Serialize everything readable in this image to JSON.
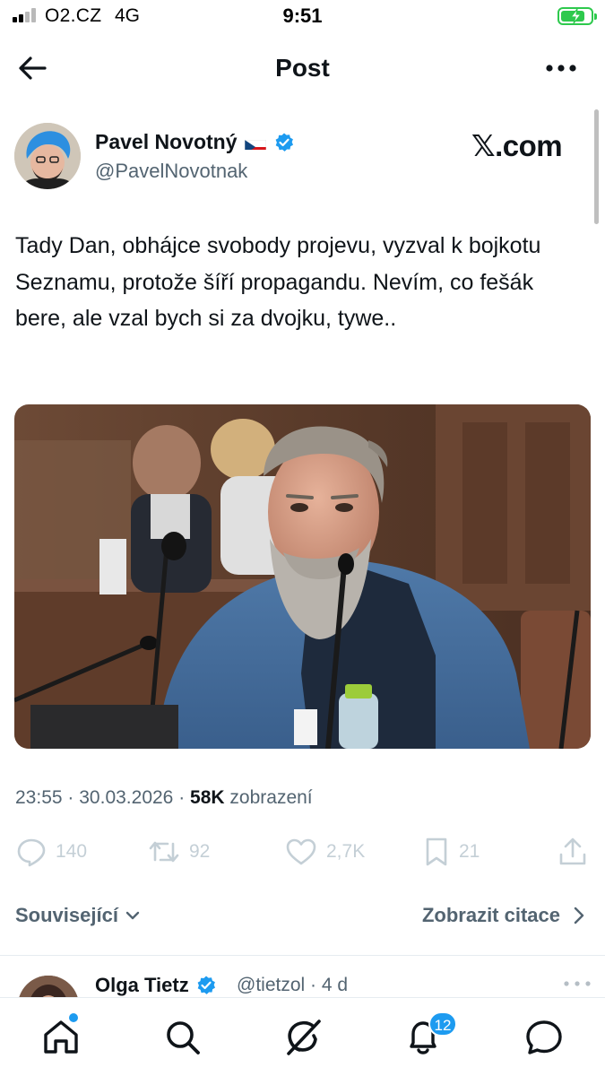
{
  "status_bar": {
    "carrier": "O2.CZ",
    "network": "4G",
    "time": "9:51",
    "battery_color": "#2ec94d",
    "signal_bars": 4,
    "signal_active": 2
  },
  "header": {
    "title": "Post",
    "back_icon": "arrow-left-icon",
    "more_icon": "more-horizontal-icon"
  },
  "author": {
    "name": "Pavel Novotný",
    "flag_icon": "czech-flag-icon",
    "verified_icon": "verified-badge-icon",
    "handle": "@PavelNovotnak",
    "watermark": "𝕏.com"
  },
  "post": {
    "text": "Tady Dan, obhájce svobody projevu, vyzval k bojkotu Seznamu, protože šíří propagandu. Nevím, co fešák bere, ale vzal bych si za dvojku, tywe..",
    "time": "23:55",
    "date": "30.03.2026",
    "views": "58K",
    "views_label": "zobrazení",
    "separator": "·"
  },
  "actions": {
    "replies": "140",
    "reposts": "92",
    "likes": "2,7K",
    "bookmarks": "21",
    "muted_color": "#c4cfd6"
  },
  "related": {
    "left_label": "Související",
    "right_label": "Zobrazit citace"
  },
  "reply_preview": {
    "name": "Olga Tietz",
    "handle": "@tietzol",
    "age": "· 4 d"
  },
  "tabbar": {
    "items": [
      "home-icon",
      "search-icon",
      "grok-icon",
      "notifications-icon",
      "messages-icon"
    ],
    "notifications_badge": "12",
    "accent": "#1d9bf0"
  }
}
